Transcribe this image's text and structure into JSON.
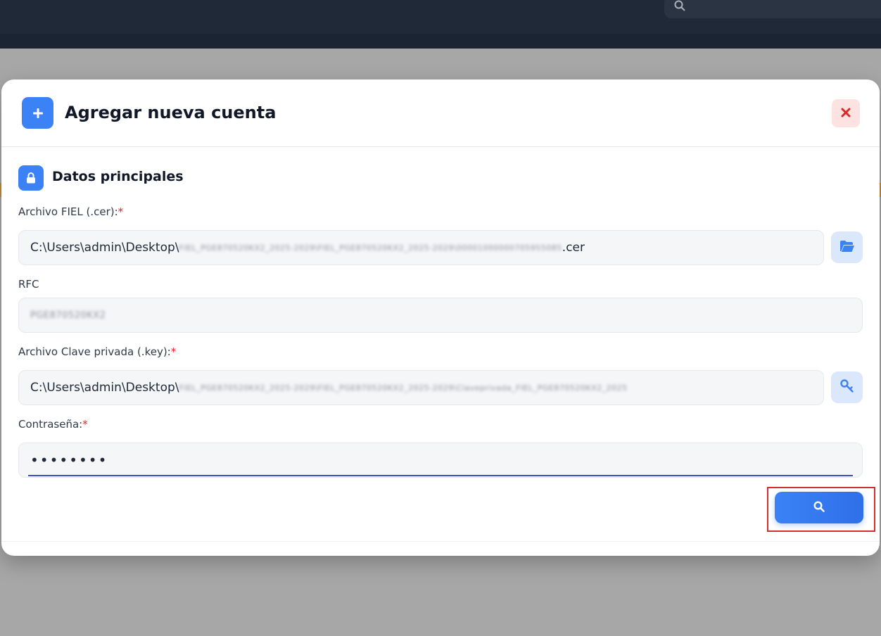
{
  "modal": {
    "title": "Agregar nueva cuenta",
    "section_title": "Datos principales",
    "fiel_label": "Archivo FIEL (.cer):",
    "fiel_path_prefix": "C:\\Users\\admin\\Desktop\\",
    "fiel_path_redacted": "FIEL_PGE870520KX2_2025-2029\\FIEL_PGE870520KX2_2025-2029\\00001000000705955085",
    "fiel_path_suffix": ".cer",
    "rfc_label": "RFC",
    "rfc_value_redacted": "PGE870520KX2",
    "key_label": "Archivo Clave privada (.key):",
    "key_path_prefix": "C:\\Users\\admin\\Desktop\\",
    "key_path_redacted": "FIEL_PGE870520KX2_2025-2029\\FIEL_PGE870520KX2_2025-2029\\Claveprivada_FIEL_PGE870520KX2_2025",
    "password_label": "Contraseña:",
    "password_value": "••••••••",
    "required_mark": "*"
  },
  "icons": {
    "header": "plus-icon",
    "close": "close-icon",
    "section": "lock-icon",
    "fiel_browse": "folder-open-icon",
    "key_browse": "key-icon",
    "submit": "search-icon"
  },
  "colors": {
    "accent": "#3b82f6",
    "close_bg": "#fde2e2",
    "close_icon": "#dc2626",
    "required": "#dc2626",
    "highlight": "#d32f2f"
  }
}
